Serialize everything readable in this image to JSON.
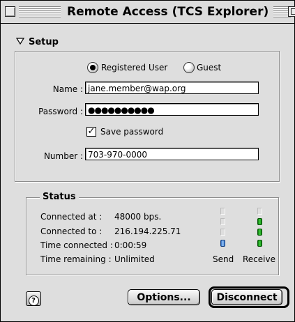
{
  "window": {
    "title": "Remote Access (TCS Explorer)"
  },
  "setup": {
    "heading": "Setup",
    "user_type": {
      "registered_label": "Registered User",
      "guest_label": "Guest",
      "selected": "Registered User"
    },
    "name": {
      "label": "Name :",
      "value": "jane.member@wap.org"
    },
    "password": {
      "label": "Password :",
      "value": "●●●●●●●●●●"
    },
    "save_password": {
      "label": "Save password",
      "checked": true
    },
    "number": {
      "label": "Number :",
      "value": "703-970-0000"
    }
  },
  "status": {
    "heading": "Status",
    "rows": [
      {
        "label": "Connected at :",
        "value": "48000 bps."
      },
      {
        "label": "Connected to :",
        "value": "216.194.225.71"
      },
      {
        "label": "Time connected :",
        "value": "0:00:59"
      },
      {
        "label": "Time remaining :",
        "value": "Unlimited"
      }
    ],
    "meters": {
      "send": {
        "label": "Send",
        "active_segments": 1,
        "total_segments": 4,
        "color": "#5a9be6"
      },
      "receive": {
        "label": "Receive",
        "active_segments": 3,
        "total_segments": 4,
        "color": "#22a822"
      }
    }
  },
  "buttons": {
    "help_icon": "?",
    "options": "Options...",
    "disconnect": "Disconnect"
  }
}
